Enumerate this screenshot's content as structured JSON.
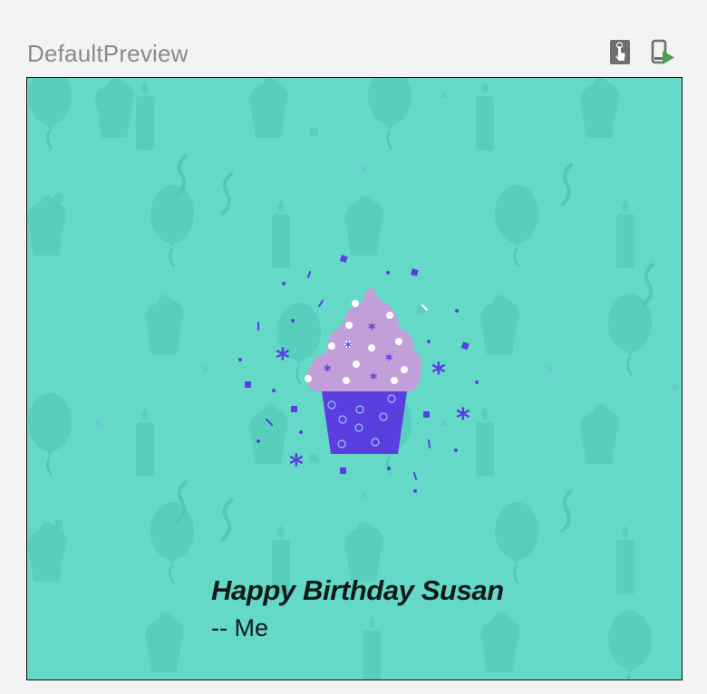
{
  "preview": {
    "title": "DefaultPreview",
    "toolbar": {
      "interactive_icon": "interactive-mode-icon",
      "deploy_icon": "deploy-to-device-icon"
    }
  },
  "card": {
    "greeting": "Happy Birthday Susan",
    "signature": "-- Me",
    "colors": {
      "background": "#64d9c7",
      "pattern": "#52c8b6",
      "frosting": "#c39fd9",
      "cup": "#5a3ee0",
      "confetti": "#5a3ee0",
      "text": "#111a19"
    }
  }
}
